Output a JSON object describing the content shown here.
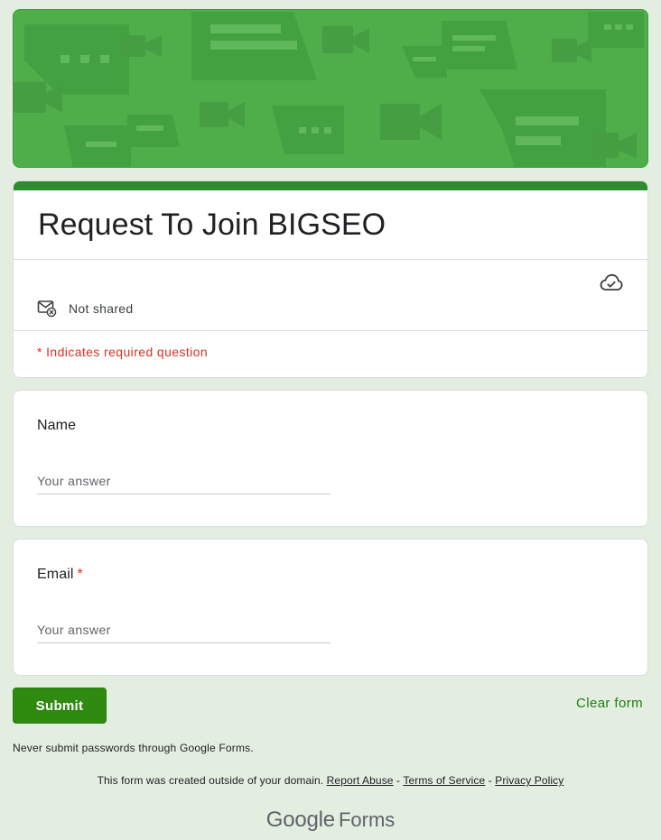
{
  "form": {
    "title": "Request To Join BIGSEO",
    "share_status": "Not shared",
    "required_note": "* Indicates required question",
    "accent_color": "#2e8b10"
  },
  "questions": [
    {
      "label": "Name",
      "required": false,
      "placeholder": "Your answer"
    },
    {
      "label": "Email",
      "required": true,
      "required_mark": "*",
      "placeholder": "Your answer"
    }
  ],
  "actions": {
    "submit_label": "Submit",
    "clear_label": "Clear form"
  },
  "footer": {
    "warning": "Never submit passwords through Google Forms.",
    "domain_note": "This form was created outside of your domain.",
    "report_abuse": "Report Abuse",
    "separator": "-",
    "terms": "Terms of Service",
    "privacy": "Privacy Policy",
    "brand_google": "Google",
    "brand_forms": "Forms"
  },
  "icons": {
    "cloud": "cloud-check-icon",
    "mail": "mail-not-shared-icon"
  }
}
